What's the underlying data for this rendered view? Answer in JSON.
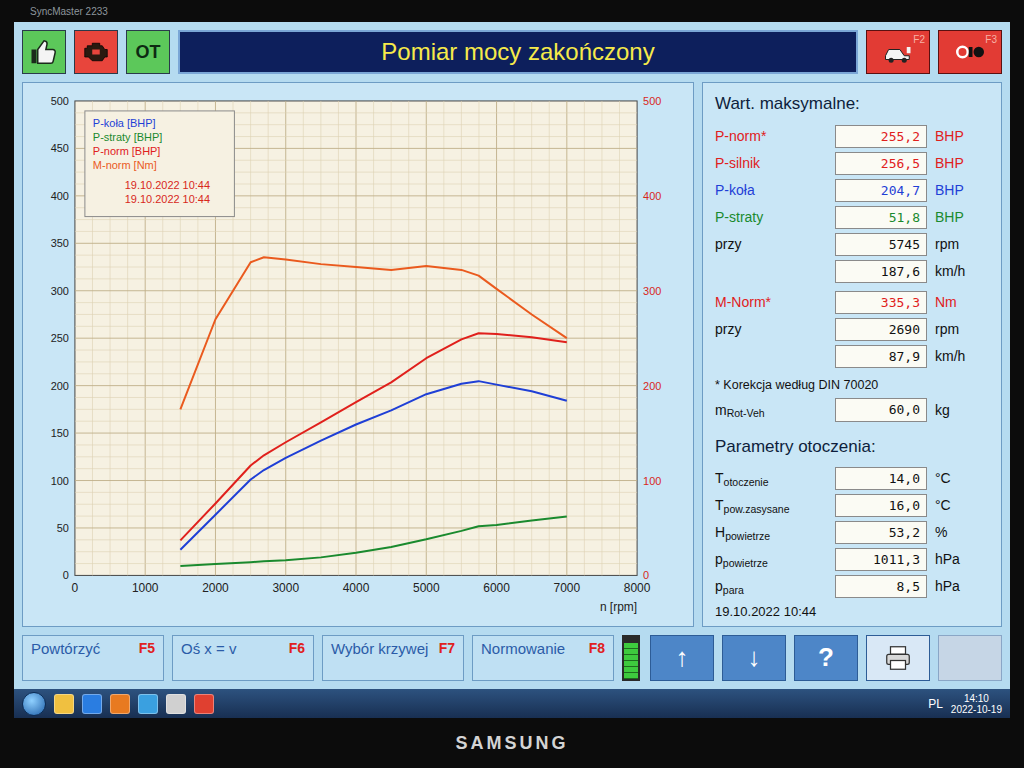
{
  "monitor": {
    "model": "SyncMaster 2233",
    "brand": "SAMSUNG"
  },
  "header": {
    "status": [
      {
        "kind": "thumb",
        "color": "#5cc85a"
      },
      {
        "kind": "engine",
        "color": "#e8453c"
      },
      {
        "kind": "text",
        "label": "OT",
        "color": "#5cc85a"
      }
    ],
    "title": "Pomiar mocy zakończony",
    "function_keys": [
      {
        "kind": "car",
        "key": "F2",
        "color": "#e23b34"
      },
      {
        "kind": "rollers",
        "key": "F3",
        "color": "#e23b34"
      }
    ]
  },
  "chart": {
    "x_max": 8000,
    "y_max": 500,
    "x_ticks": [
      "0",
      "1000",
      "2000",
      "3000",
      "4000",
      "5000",
      "6000",
      "7000",
      "8000"
    ],
    "y_left_ticks": [
      "0",
      "50",
      "100",
      "150",
      "200",
      "250",
      "300",
      "350",
      "400",
      "450",
      "500"
    ],
    "y_right_ticks": [
      "0",
      "100",
      "200",
      "300",
      "400",
      "500"
    ],
    "x_label": "n [rpm]",
    "rpm": [
      1500,
      2000,
      2500,
      2690,
      3000,
      3500,
      4000,
      4500,
      5000,
      5500,
      5745,
      6000,
      6500,
      7000
    ],
    "series": [
      {
        "label": "P-koła [BHP]",
        "color": "#1f3fd6",
        "values": [
          27,
          64,
          101,
          111,
          124,
          142,
          159,
          174,
          191,
          202,
          204.7,
          201,
          194,
          184
        ]
      },
      {
        "label": "P-straty [BHP]",
        "color": "#1a8a2e",
        "values": [
          10,
          12,
          14,
          15,
          16,
          19,
          24,
          30,
          38,
          47,
          51.8,
          53,
          58,
          62
        ]
      },
      {
        "label": "P-norm [BHP]",
        "color": "#e0201c",
        "values": [
          36.9,
          75.8,
          115.9,
          126.6,
          140.3,
          161.2,
          182.6,
          203.5,
          228.9,
          248.7,
          255.2,
          254.5,
          251.1,
          245.8
        ]
      },
      {
        "label": "M-norm [Nm]",
        "color": "#ea5a1e",
        "values": [
          175,
          270,
          330,
          335.3,
          333,
          328,
          325,
          322,
          326,
          322,
          316,
          302,
          275,
          250
        ]
      }
    ],
    "legend_dates": [
      "19.10.2022 10:44",
      "19.10.2022 10:44"
    ]
  },
  "max_values": {
    "title": "Wart. maksymalne:",
    "power": [
      {
        "label": "P-norm*",
        "value": "255,2",
        "unit": "BHP",
        "color": "#e0201c"
      },
      {
        "label": "P-silnik",
        "value": "256,5",
        "unit": "BHP",
        "color": "#e0201c"
      },
      {
        "label": "P-koła",
        "value": "204,7",
        "unit": "BHP",
        "color": "#1f3fd6"
      },
      {
        "label": "P-straty",
        "value": "51,8",
        "unit": "BHP",
        "color": "#1a8a2e"
      },
      {
        "label": "przy",
        "value": "5745",
        "unit": "rpm",
        "color": "#111111"
      },
      {
        "label": "",
        "value": "187,6",
        "unit": "km/h",
        "color": "#111111"
      }
    ],
    "torque": [
      {
        "label": "M-Norm*",
        "value": "335,3",
        "unit": "Nm",
        "color": "#e0201c"
      },
      {
        "label": "przy",
        "value": "2690",
        "unit": "rpm",
        "color": "#111111"
      },
      {
        "label": "",
        "value": "87,9",
        "unit": "km/h",
        "color": "#111111"
      }
    ],
    "note": "* Korekcja według DIN 70020",
    "mass": {
      "label": "m",
      "sub": "Rot-Veh",
      "value": "60,0",
      "unit": "kg"
    }
  },
  "ambient": {
    "title": "Parametry otoczenia:",
    "rows": [
      {
        "label": "T",
        "sub": "otoczenie",
        "value": "14,0",
        "unit": "°C"
      },
      {
        "label": "T",
        "sub": "pow.zasysane",
        "value": "16,0",
        "unit": "°C"
      },
      {
        "label": "H",
        "sub": "powietrze",
        "value": "53,2",
        "unit": "%"
      },
      {
        "label": "p",
        "sub": "powietrze",
        "value": "1011,3",
        "unit": "hPa"
      },
      {
        "label": "p",
        "sub": "para",
        "value": "8,5",
        "unit": "hPa"
      }
    ]
  },
  "date": "19.10.2022 10:44",
  "footer": {
    "buttons": [
      {
        "label": "Powtórzyć",
        "key": "F5"
      },
      {
        "label": "Oś x = v",
        "key": "F6"
      },
      {
        "label": "Wybór krzywej",
        "key": "F7"
      },
      {
        "label": "Normowanie",
        "key": "F8"
      }
    ],
    "indicator": {
      "level": 0.85
    },
    "nav": [
      {
        "kind": "text",
        "label": "↑"
      },
      {
        "kind": "text",
        "label": "↓"
      },
      {
        "kind": "text",
        "label": "?"
      },
      {
        "kind": "print"
      },
      {
        "kind": "blank"
      }
    ]
  },
  "taskbar": {
    "apps": [
      {
        "color": "#f0c040"
      },
      {
        "color": "#2a7de1"
      },
      {
        "color": "#e87a20"
      },
      {
        "color": "#3aa0e0"
      },
      {
        "color": "#d0d0d0"
      },
      {
        "color": "#e04030"
      }
    ],
    "language": "PL",
    "time": "14:10",
    "date": "2022-10-19"
  }
}
